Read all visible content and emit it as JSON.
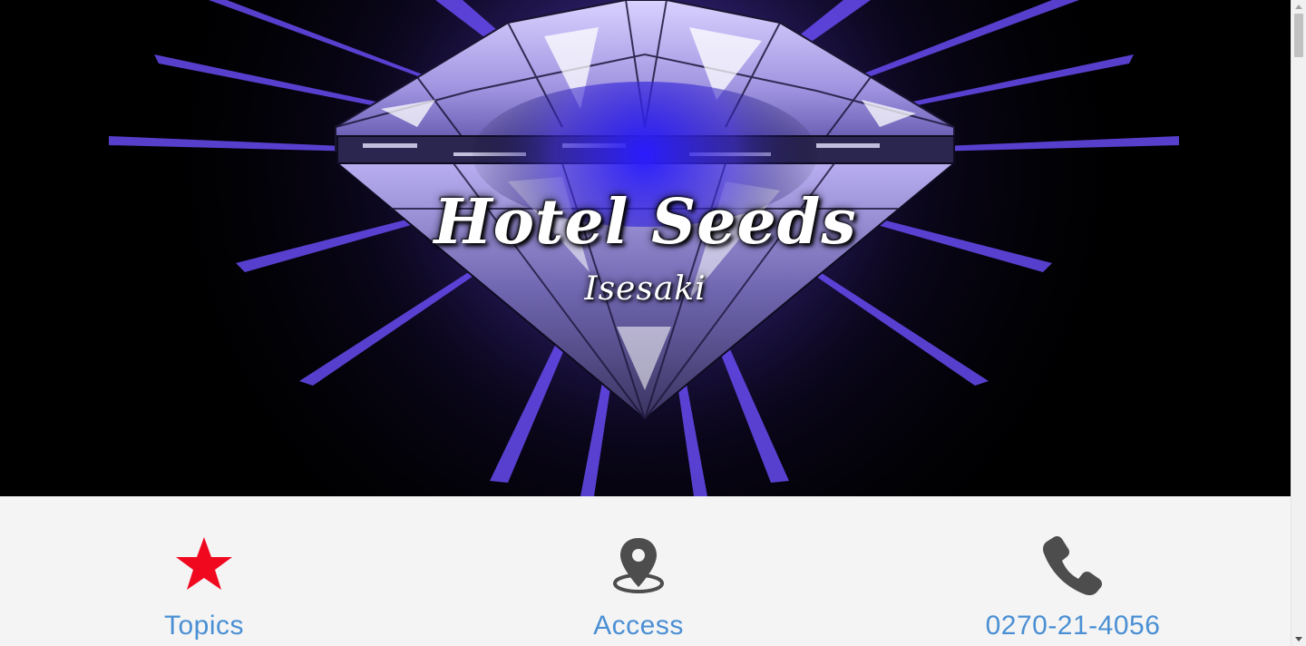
{
  "hero": {
    "title": "Hotel Seeds",
    "subtitle": "Isesaki"
  },
  "info": {
    "items": [
      {
        "label": "Topics",
        "icon": "star-icon",
        "color": "#f0081f"
      },
      {
        "label": "Access",
        "icon": "map-pin-icon",
        "color": "#4d4d4d"
      },
      {
        "label": "0270-21-4056",
        "icon": "phone-icon",
        "color": "#4d4d4d"
      }
    ],
    "label_color": "#4a8fd4"
  },
  "colors": {
    "hero_background": "#000000",
    "glow": "#6a4bff",
    "page_background": "#f4f4f4"
  }
}
